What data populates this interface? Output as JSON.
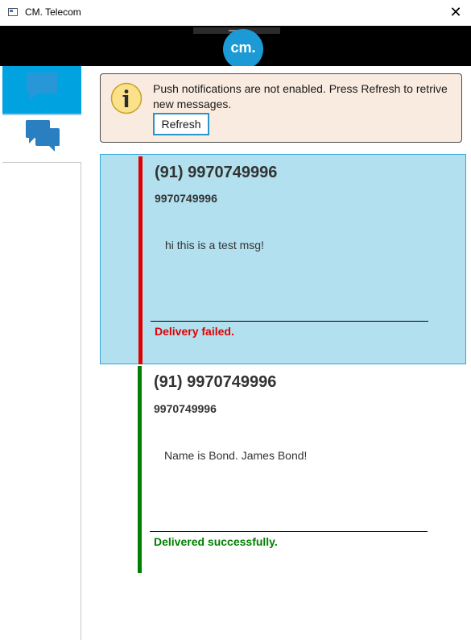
{
  "window": {
    "title": "CM. Telecom",
    "close_glyph": "✕"
  },
  "header": {
    "logo_text": "cm.",
    "logo_color": "#1b9ad6"
  },
  "sidebar": {
    "items": [
      {
        "icon": "chat-bubbles-icon",
        "active": true,
        "accent": "#00a3e0"
      },
      {
        "icon": "chat-bubbles-icon",
        "active": false,
        "accent": "#2a7fc1"
      }
    ]
  },
  "banner": {
    "icon": "info-icon",
    "message": "Push notifications are not enabled. Press Refresh to retrive new messages.",
    "refresh_label": "Refresh"
  },
  "messages": [
    {
      "sender": "(91) 9970749996",
      "number": "9970749996",
      "text": "hi this is a test msg!",
      "status": "Delivery failed.",
      "status_color": "#e00000",
      "selected": true
    },
    {
      "sender": "(91) 9970749996",
      "number": "9970749996",
      "text": "Name is Bond. James Bond!",
      "status": "Delivered successfully.",
      "status_color": "#008000",
      "selected": false
    }
  ]
}
